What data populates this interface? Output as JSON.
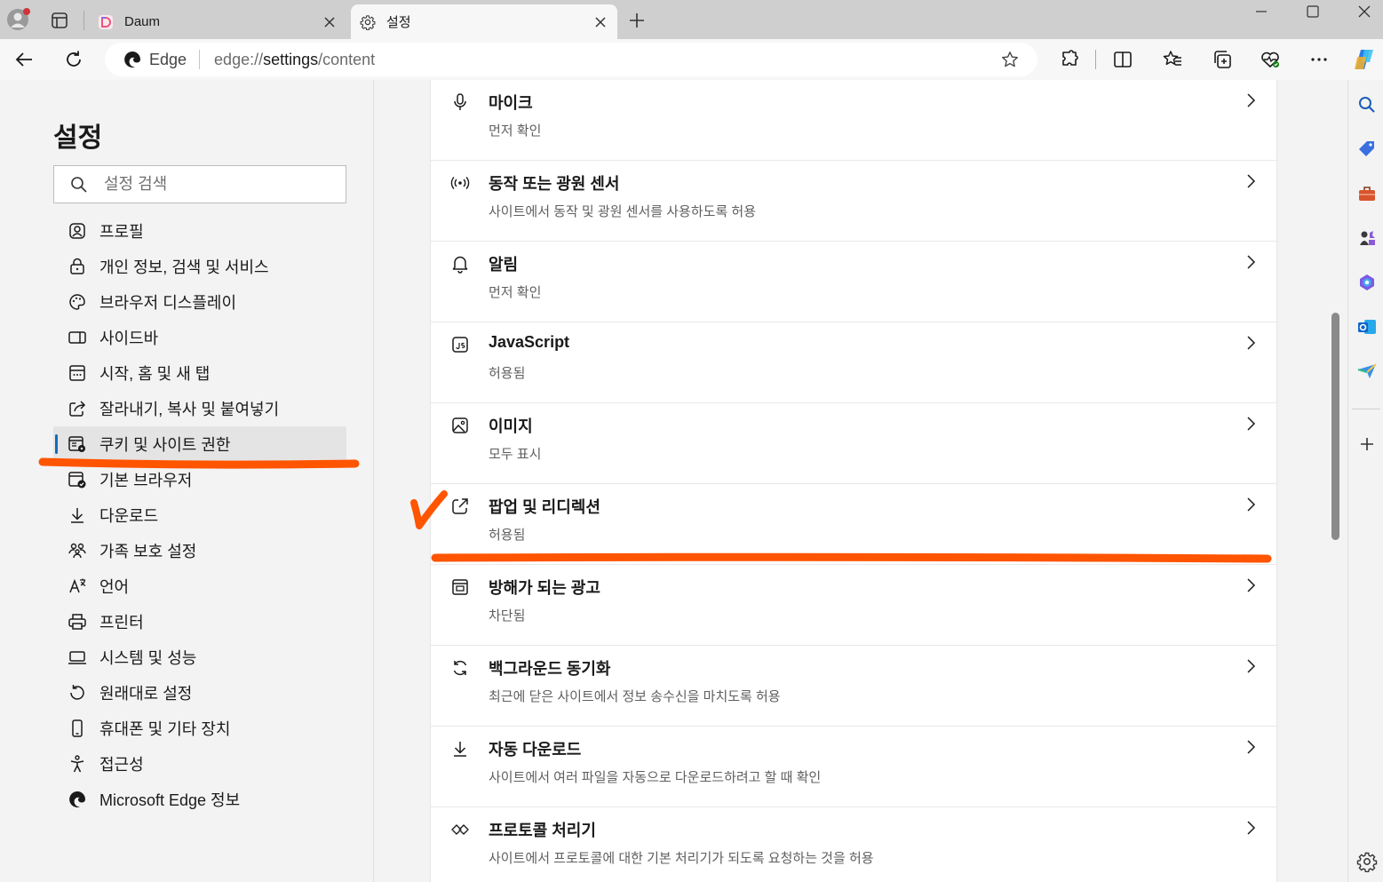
{
  "tabs": [
    {
      "title": "Daum",
      "active": false
    },
    {
      "title": "설정",
      "active": true
    }
  ],
  "address_bar": {
    "site_label": "Edge",
    "url_scheme": "edge://",
    "url_host": "settings",
    "url_path": "/content"
  },
  "sidebar": {
    "title": "설정",
    "search_placeholder": "설정 검색",
    "items": [
      {
        "label": "프로필",
        "icon": "profile-icon"
      },
      {
        "label": "개인 정보, 검색 및 서비스",
        "icon": "lock-icon"
      },
      {
        "label": "브라우저 디스플레이",
        "icon": "palette-icon"
      },
      {
        "label": "사이드바",
        "icon": "sidebar-icon"
      },
      {
        "label": "시작, 홈 및 새 탭",
        "icon": "home-tab-icon"
      },
      {
        "label": "잘라내기, 복사 및 붙여넣기",
        "icon": "share-icon"
      },
      {
        "label": "쿠키 및 사이트 권한",
        "icon": "site-permissions-icon",
        "selected": true
      },
      {
        "label": "기본 브라우저",
        "icon": "default-browser-icon"
      },
      {
        "label": "다운로드",
        "icon": "download-icon"
      },
      {
        "label": "가족 보호 설정",
        "icon": "family-icon"
      },
      {
        "label": "언어",
        "icon": "language-icon"
      },
      {
        "label": "프린터",
        "icon": "printer-icon"
      },
      {
        "label": "시스템 및 성능",
        "icon": "system-icon"
      },
      {
        "label": "원래대로 설정",
        "icon": "reset-icon"
      },
      {
        "label": "휴대폰 및 기타 장치",
        "icon": "phone-icon"
      },
      {
        "label": "접근성",
        "icon": "accessibility-icon"
      },
      {
        "label": "Microsoft Edge 정보",
        "icon": "edge-logo-icon"
      }
    ]
  },
  "permissions": [
    {
      "title": "마이크",
      "desc": "먼저 확인",
      "icon": "microphone-icon"
    },
    {
      "title": "동작 또는 광원 센서",
      "desc": "사이트에서 동작 및 광원 센서를 사용하도록 허용",
      "icon": "sensor-icon"
    },
    {
      "title": "알림",
      "desc": "먼저 확인",
      "icon": "bell-icon"
    },
    {
      "title": "JavaScript",
      "desc": "허용됨",
      "icon": "javascript-icon"
    },
    {
      "title": "이미지",
      "desc": "모두 표시",
      "icon": "image-icon"
    },
    {
      "title": "팝업 및 리디렉션",
      "desc": "허용됨",
      "icon": "popup-icon"
    },
    {
      "title": "방해가 되는 광고",
      "desc": "차단됨",
      "icon": "ads-icon"
    },
    {
      "title": "백그라운드 동기화",
      "desc": "최근에 닫은 사이트에서 정보 송수신을 마치도록 허용",
      "icon": "sync-icon"
    },
    {
      "title": "자동 다운로드",
      "desc": "사이트에서 여러 파일을 자동으로 다운로드하려고 할 때 확인",
      "icon": "download-icon"
    },
    {
      "title": "프로토콜 처리기",
      "desc": "사이트에서 프로토콜에 대한 기본 처리기가 되도록 요청하는 것을 허용",
      "icon": "protocol-icon"
    }
  ],
  "colors": {
    "annotation": "#ff5400",
    "accent": "#0f6cbd"
  }
}
